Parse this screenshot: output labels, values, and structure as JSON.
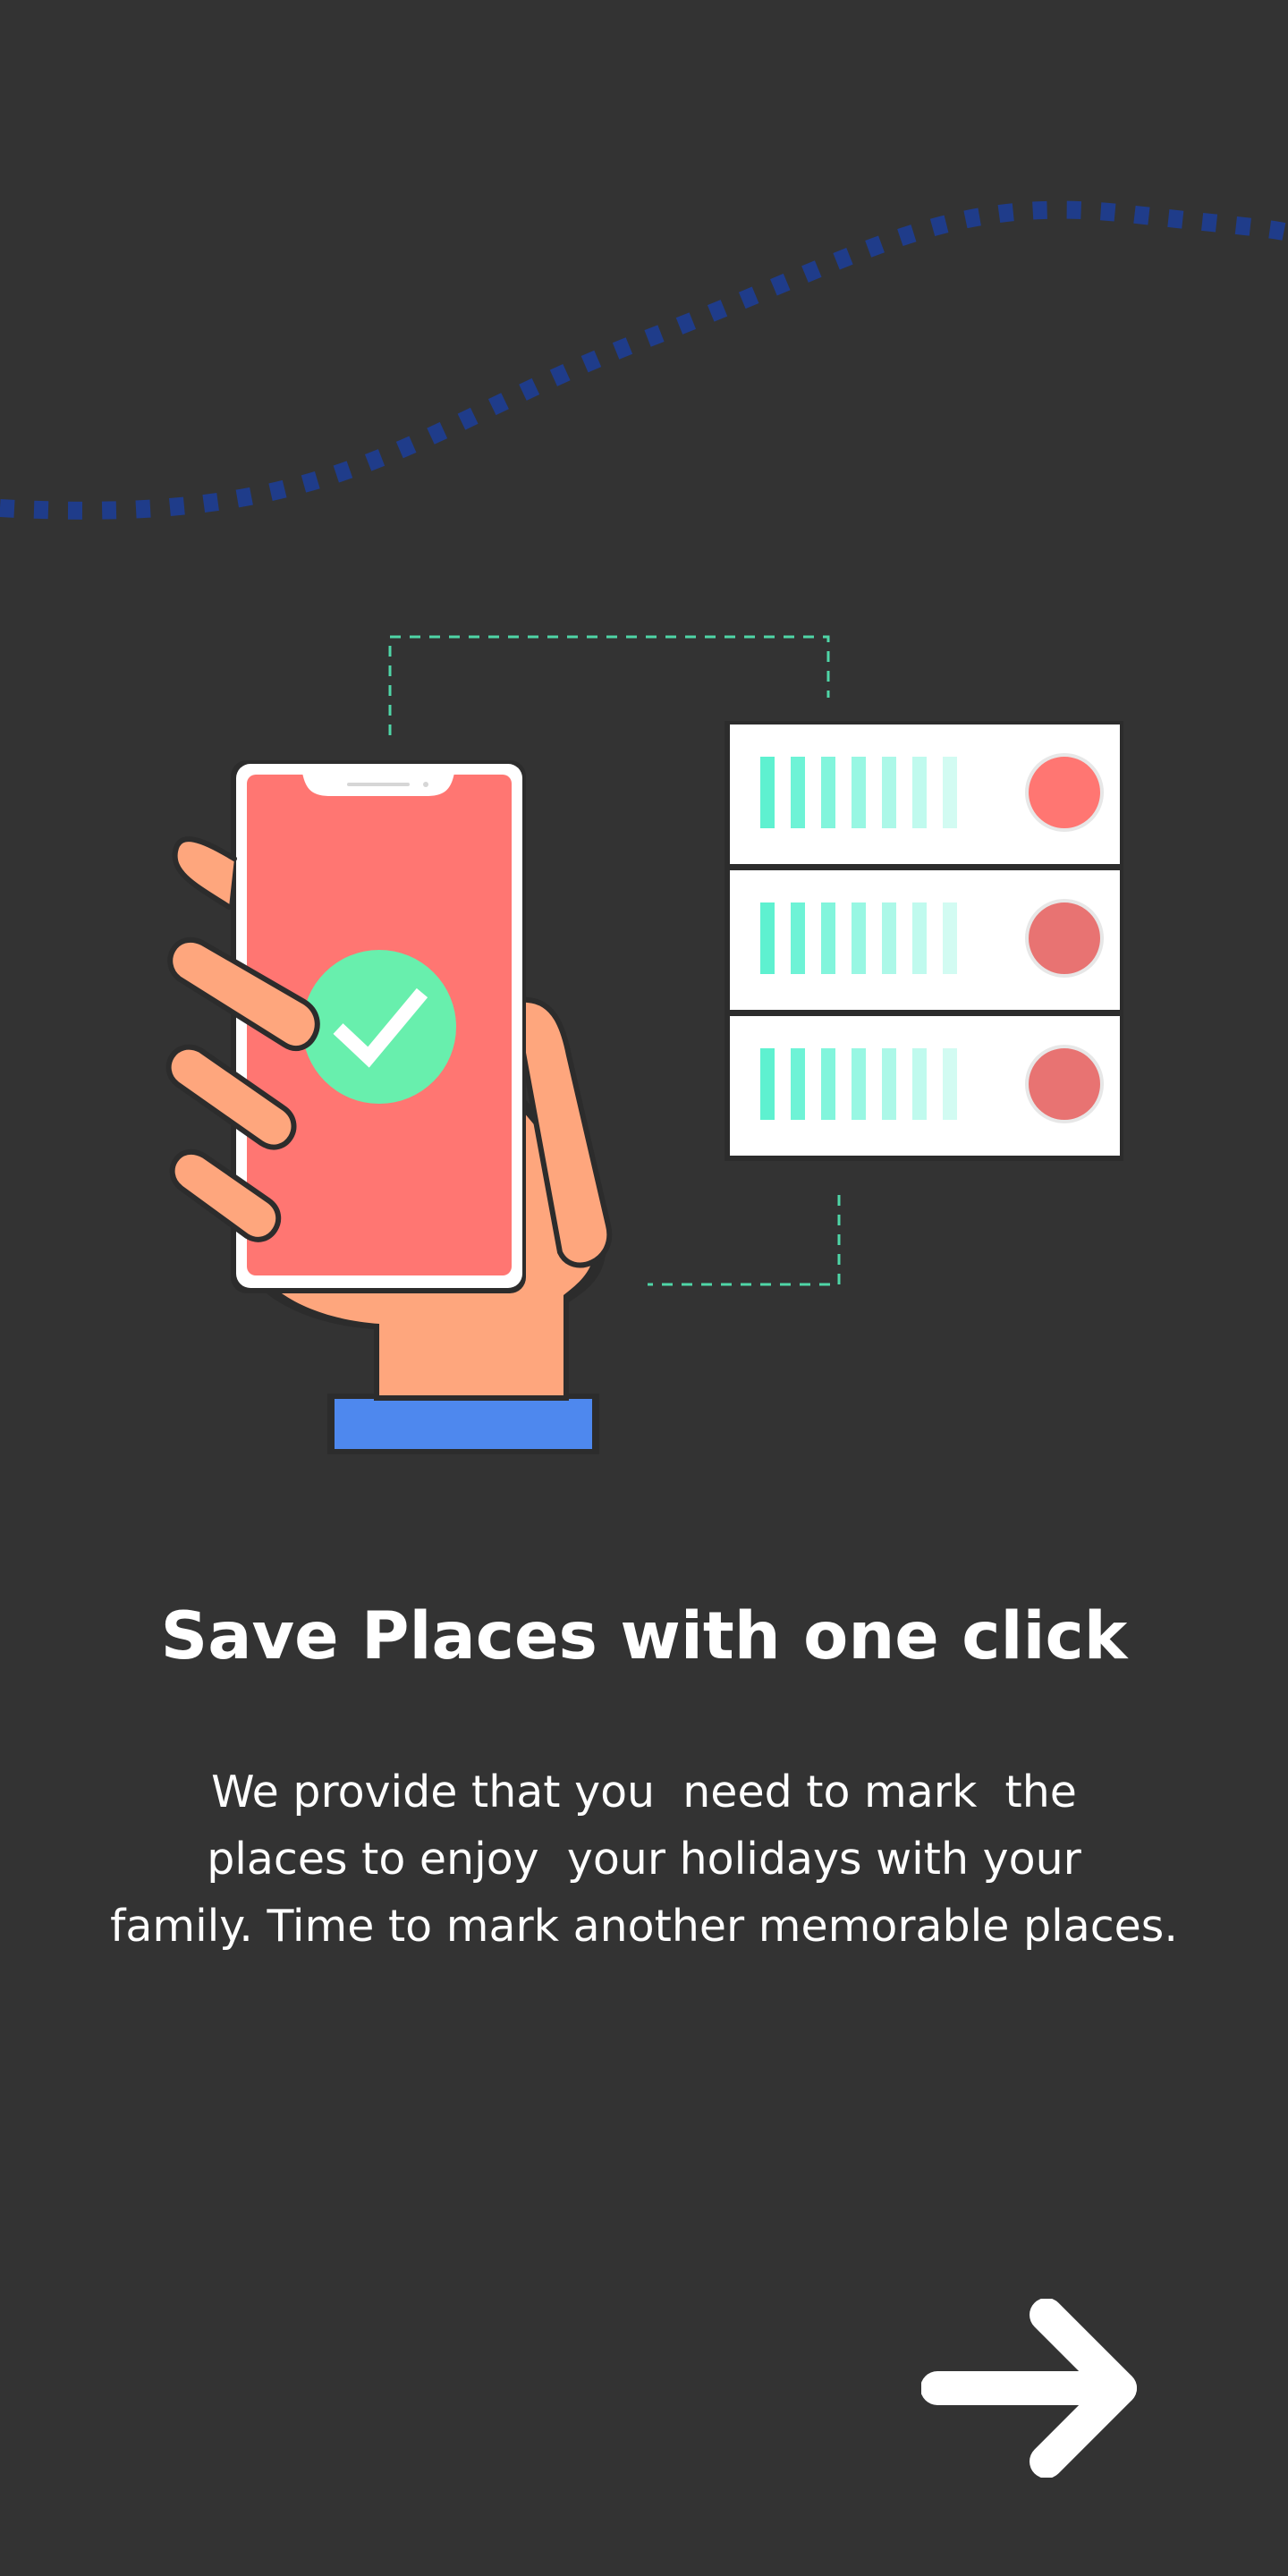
{
  "onboarding": {
    "title": "Save Places with one click",
    "description_lines": [
      "We provide that you  need to mark  the",
      "places to enjoy  your holidays with your",
      "family. Time to mark another memorable places."
    ]
  },
  "icons": {
    "next": "arrow-right-icon",
    "illustration": "phone-sync-server-illustration",
    "check": "checkmark-icon"
  },
  "colors": {
    "background": "#333333",
    "wave": "#1f3c8a",
    "phone_screen": "#ff7672",
    "check_circle": "#68efad",
    "skin": "#fea67d",
    "cuff": "#4e88ee",
    "server_bars": "#5ef1d0",
    "server_led": "#ff7672",
    "dashed_link": "#4fd6a7",
    "text": "#ffffff"
  }
}
